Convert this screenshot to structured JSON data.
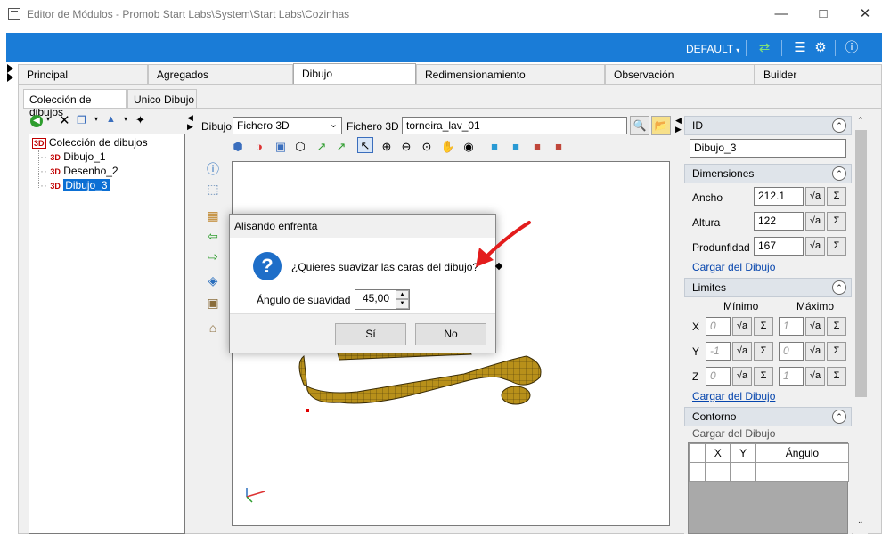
{
  "window": {
    "title": "Editor de Módulos - Promob Start Labs\\System\\Start Labs\\Cozinhas"
  },
  "toolbar": {
    "profile": "DEFAULT"
  },
  "main_tabs": [
    "Principal",
    "Agregados",
    "Dibujo",
    "Redimensionamiento",
    "Observación",
    "Builder"
  ],
  "sub_tabs": [
    "Colección de dibujos",
    "Unico Dibujo"
  ],
  "tree": {
    "root": "Colección de dibujos",
    "items": [
      "Dibujo_1",
      "Desenho_2",
      "Dibujo_3"
    ],
    "badge": "3D"
  },
  "drawing": {
    "dibujo_label": "Dibujo",
    "dibujo_value": "Fichero 3D",
    "fichero_label": "Fichero 3D",
    "fichero_value": "torneira_lav_01"
  },
  "dialog": {
    "title": "Alisando enfrenta",
    "question": "¿Quieres suavizar las caras del dibujo?",
    "angle_label": "Ángulo de suavidad",
    "angle_value": "45,00",
    "yes": "Sí",
    "no": "No"
  },
  "props": {
    "id_header": "ID",
    "id_value": "Dibujo_3",
    "dim_header": "Dimensiones",
    "ancho_label": "Ancho",
    "ancho_value": "212.1",
    "altura_label": "Altura",
    "altura_value": "122",
    "prof_label": "Produnfidad",
    "prof_value": "167",
    "cargar": "Cargar del Dibujo",
    "limites_header": "Limites",
    "minimo": "Mínimo",
    "maximo": "Máximo",
    "x_label": "X",
    "y_label": "Y",
    "z_label": "Z",
    "x_min": "0",
    "x_max": "1",
    "y_min": "-1",
    "y_max": "0",
    "z_min": "0",
    "z_max": "1",
    "contorno_header": "Contorno",
    "contorno_sub": "Cargar del Dibujo",
    "col_x": "X",
    "col_y": "Y",
    "col_ang": "Ángulo"
  },
  "colors": {
    "accent": "#1a7cd7",
    "selection": "#0b6fd4",
    "annotation_arrow": "#e31c1c",
    "model": "#b8901a"
  }
}
